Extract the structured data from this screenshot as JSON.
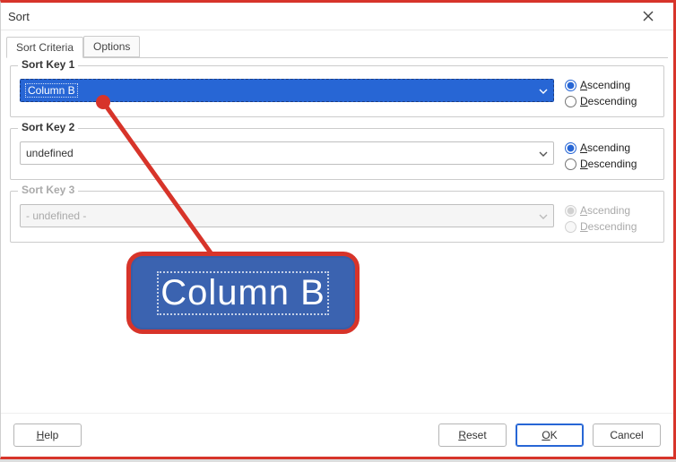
{
  "window": {
    "title": "Sort"
  },
  "tabs": {
    "criteria": "Sort Criteria",
    "options": "Options"
  },
  "key1": {
    "legend": "Sort Key 1",
    "value": "Column B",
    "asc_label": "Ascending",
    "asc_mn": "A",
    "desc_label": "Descending",
    "desc_mn": "D",
    "selected": "asc"
  },
  "key2": {
    "legend": "Sort Key 2",
    "value": "undefined",
    "asc_label": "Ascending",
    "asc_mn": "A",
    "desc_label": "Descending",
    "desc_mn": "D",
    "selected": "asc"
  },
  "key3": {
    "legend": "Sort Key 3",
    "value": "- undefined -",
    "asc_label": "Ascending",
    "asc_mn": "A",
    "desc_label": "Descending",
    "desc_mn": "D",
    "selected": "asc"
  },
  "buttons": {
    "help": "Help",
    "help_mn": "H",
    "reset": "Reset",
    "reset_mn": "R",
    "ok": "OK",
    "ok_mn": "O",
    "cancel": "Cancel"
  },
  "callout": {
    "text": "Column B"
  },
  "colors": {
    "accent": "#2766d5",
    "callout_red": "#d7342a",
    "callout_fill": "#3b63b0"
  }
}
